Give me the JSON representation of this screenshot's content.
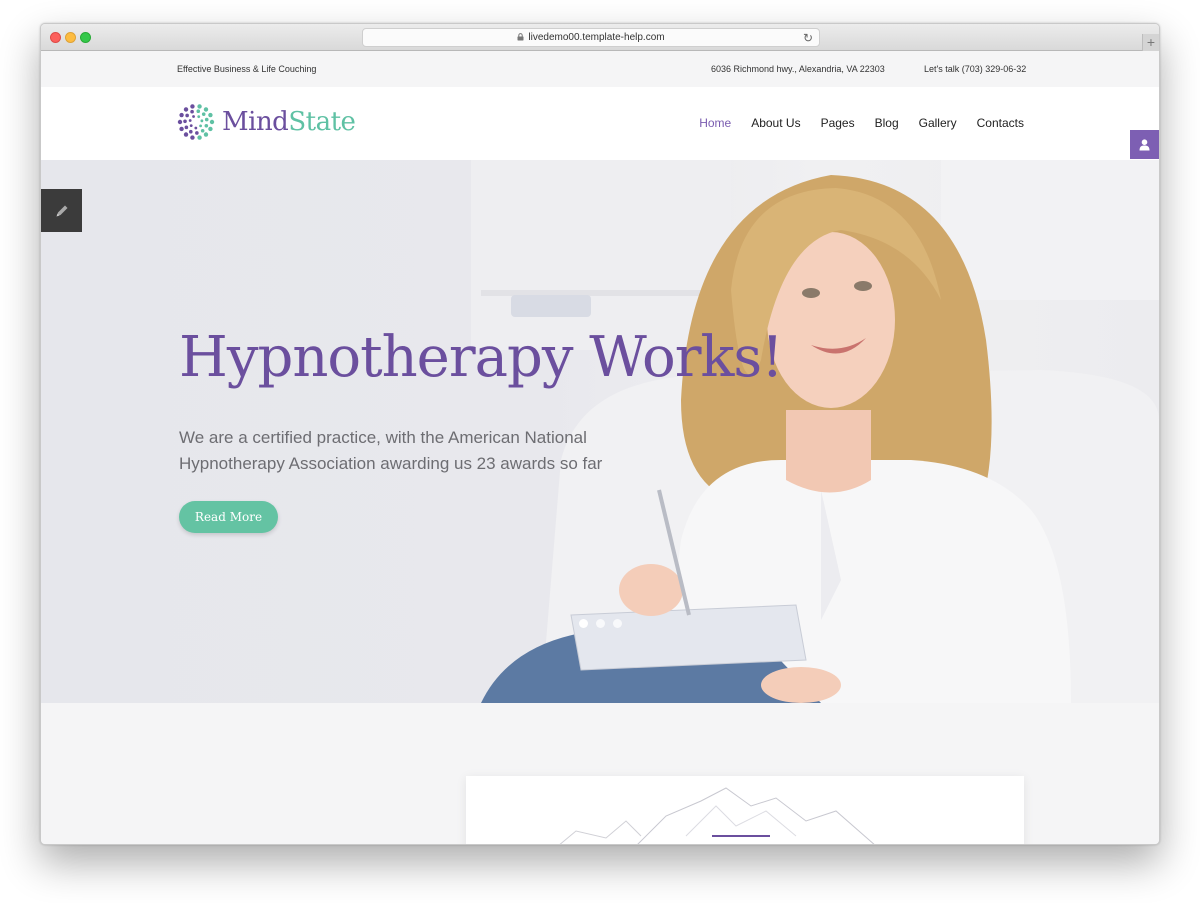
{
  "browser": {
    "url": "livedemo00.template-help.com"
  },
  "topbar": {
    "tagline": "Effective Business & Life Couching",
    "address": "6036 Richmond hwy., Alexandria, VA 22303",
    "phone": "Let's talk (703) 329-06-32"
  },
  "header": {
    "logo_part1": "Mind",
    "logo_part2": "State",
    "nav": [
      {
        "label": "Home",
        "active": true
      },
      {
        "label": "About Us"
      },
      {
        "label": "Pages"
      },
      {
        "label": "Blog"
      },
      {
        "label": "Gallery"
      },
      {
        "label": "Contacts"
      }
    ]
  },
  "hero": {
    "title": "Hypnotherapy Works!",
    "text": "We are a certified practice, with the American National Hypnotherapy Association awarding us 23 awards so far",
    "button": "Read More",
    "slides": 3,
    "active_slide": 1
  },
  "icons": [
    "lock-icon",
    "reload-icon",
    "plus-icon",
    "logo-icon",
    "user-icon",
    "pencil-icon"
  ],
  "colors": {
    "brand_purple": "#6b4f9e",
    "brand_green": "#5fc1a4",
    "button_green": "#64c3a3"
  }
}
